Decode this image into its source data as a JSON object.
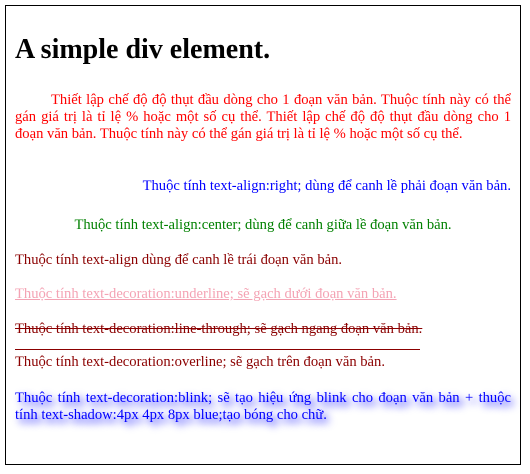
{
  "heading": "A simple div element.",
  "paragraphs": {
    "indent": "Thiết lập chế độ độ thụt đầu dòng cho 1 đoạn văn bản. Thuộc tính này có thể gán giá trị là tỉ lệ % hoặc một số cụ thể. Thiết lập chế độ độ thụt đầu dòng cho 1 đoạn văn bản. Thuộc tính này có thể gán giá trị là tỉ lệ % hoặc một số cụ thể.",
    "right": "Thuộc tính text-align:right; dùng để canh lề phải đoạn văn bản.",
    "center": "Thuộc tính text-align:center; dùng để canh giữa lề đoạn văn bản.",
    "left": "Thuộc tính text-align dùng để canh lề trái đoạn văn bản.",
    "underline": "Thuộc tính text-decoration:underline; sẽ gạch dưới đoạn văn bản.",
    "line_through": "Thuộc tính text-decoration:line-through; sẽ gạch ngang đoạn văn bản.",
    "overline": "Thuộc tính text-decoration:overline; sẽ gạch trên đoạn văn bản.",
    "blink": "Thuộc tính text-decoration:blink; sẽ tạo hiệu ứng blink cho đoạn văn bản + thuộc tính text-shadow:4px 4px 8px blue;tạo bóng cho chữ."
  },
  "colors": {
    "indent": "#ff0000",
    "right": "#0000ff",
    "center": "#008000",
    "left": "#8b0000",
    "underline": "#f4a3b4",
    "line_through": "#8b0000",
    "overline": "#8b0000",
    "blink": "#0000ff"
  }
}
